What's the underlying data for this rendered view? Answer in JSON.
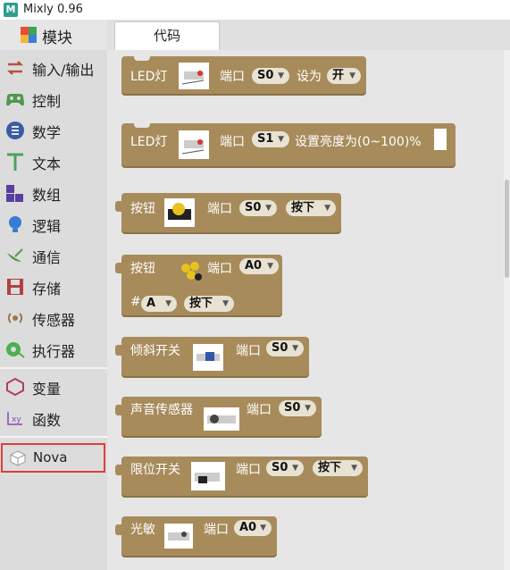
{
  "window": {
    "title": "Mixly 0.96"
  },
  "sidebar": {
    "title": "模块",
    "categories": [
      {
        "label": "输入/输出",
        "icon": "io-arrows-icon"
      },
      {
        "label": "控制",
        "icon": "gamepad-icon"
      },
      {
        "label": "数学",
        "icon": "math-icon"
      },
      {
        "label": "文本",
        "icon": "text-t-icon"
      },
      {
        "label": "数组",
        "icon": "array-blocks-icon"
      },
      {
        "label": "逻辑",
        "icon": "bulb-icon"
      },
      {
        "label": "通信",
        "icon": "satellite-icon"
      },
      {
        "label": "存储",
        "icon": "floppy-icon"
      },
      {
        "label": "传感器",
        "icon": "sensor-icon"
      },
      {
        "label": "执行器",
        "icon": "actuator-icon"
      },
      {
        "label": "变量",
        "icon": "variable-icon"
      },
      {
        "label": "函数",
        "icon": "function-icon"
      }
    ],
    "selected": {
      "label": "Nova",
      "icon": "cube-icon"
    }
  },
  "tabs": {
    "code": "代码"
  },
  "blocks": {
    "led1": {
      "name": "LED灯",
      "port_label": "端口",
      "port": "S0",
      "set_label": "设为",
      "state": "开"
    },
    "led2": {
      "name": "LED灯",
      "port_label": "端口",
      "port": "S1",
      "set_label": "设置亮度为(0~100)%"
    },
    "button1": {
      "name": "按钮",
      "port_label": "端口",
      "port": "S0",
      "state": "按下"
    },
    "button2": {
      "name": "按钮",
      "port_label": "端口",
      "port": "A0",
      "hash": "#",
      "key": "A",
      "state": "按下"
    },
    "tilt": {
      "name": "倾斜开关",
      "port_label": "端口",
      "port": "S0"
    },
    "sound": {
      "name": "声音传感器",
      "port_label": "端口",
      "port": "S0"
    },
    "limit": {
      "name": "限位开关",
      "port_label": "端口",
      "port": "S0",
      "state": "按下"
    },
    "light": {
      "name": "光敏",
      "port_label": "端口",
      "port": "A0"
    }
  },
  "colors": {
    "block": "#a78b5b",
    "highlight": "#e23b3b",
    "logo": "#2e9e8f"
  }
}
